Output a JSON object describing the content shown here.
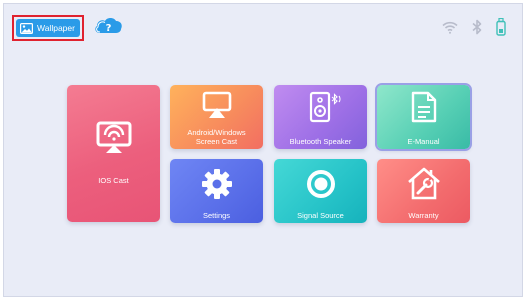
{
  "header": {
    "wallpaper_label": "Wallpaper",
    "help_icon": "cloud-question-icon",
    "status_icons": [
      "wifi-icon",
      "bluetooth-icon",
      "usb-drive-icon"
    ]
  },
  "tiles": [
    {
      "label": "IOS Cast",
      "icon": "screen-cast-icon",
      "color": "#ec5f7d"
    },
    {
      "label": "Android/Windows Screen Cast",
      "icon": "airplay-icon",
      "color": "#f78a5d"
    },
    {
      "label": "Bluetooth Speaker",
      "icon": "speaker-bluetooth-icon",
      "color": "#9d6fe6"
    },
    {
      "label": "E-Manual",
      "icon": "document-icon",
      "color": "#56cfb4"
    },
    {
      "label": "Settings",
      "icon": "gear-icon",
      "color": "#5a6fe9"
    },
    {
      "label": "Signal Source",
      "icon": "signal-ring-icon",
      "color": "#26c3c8"
    },
    {
      "label": "Warranty",
      "icon": "house-wrench-icon",
      "color": "#f36c6e"
    }
  ],
  "colors": {
    "background": "#e9ecf7",
    "accent": "#2a9be8",
    "highlight": "#e0222f"
  }
}
